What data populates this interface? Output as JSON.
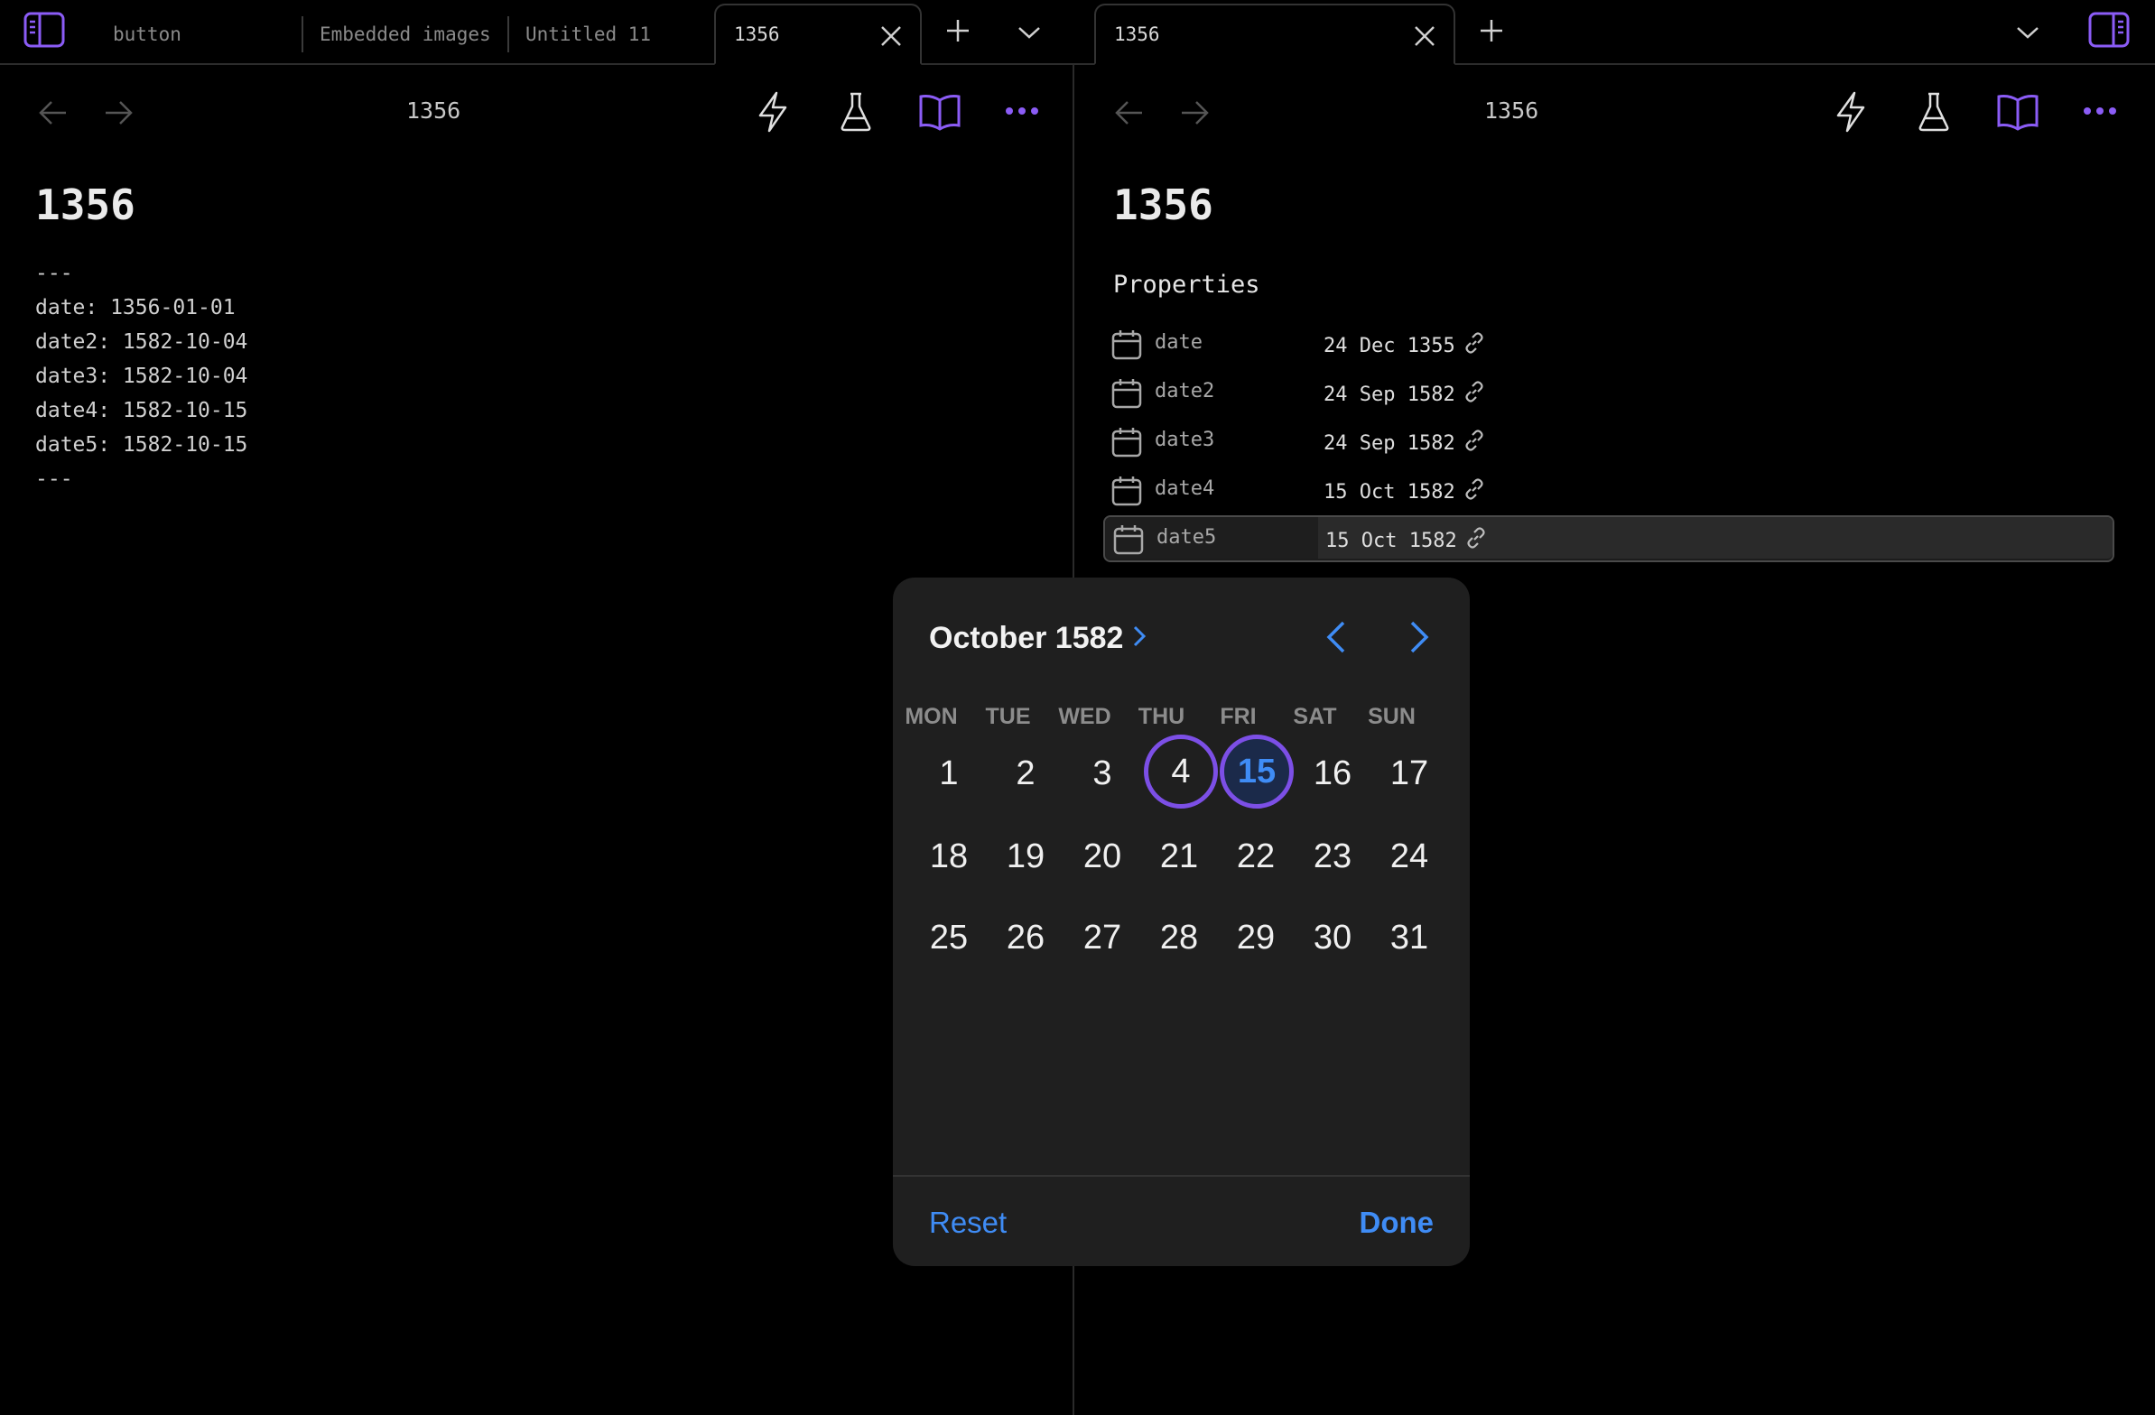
{
  "tabs": {
    "left": [
      {
        "label": "button"
      },
      {
        "label": "Embedded images"
      },
      {
        "label": "Untitled 11"
      },
      {
        "label": "1356"
      }
    ],
    "right": [
      {
        "label": "1356"
      }
    ]
  },
  "left_pane": {
    "nav_title": "1356",
    "heading": "1356",
    "source_lines": [
      "---",
      "date: 1356-01-01",
      "date2: 1582-10-04",
      "date3: 1582-10-04",
      "date4: 1582-10-15",
      "date5: 1582-10-15",
      "---"
    ]
  },
  "right_pane": {
    "nav_title": "1356",
    "heading": "1356",
    "properties_heading": "Properties",
    "properties": [
      {
        "key": "date",
        "value": "24 Dec 1355"
      },
      {
        "key": "date2",
        "value": "24 Sep 1582"
      },
      {
        "key": "date3",
        "value": "24 Sep 1582"
      },
      {
        "key": "date4",
        "value": "15 Oct 1582"
      },
      {
        "key": "date5",
        "value": "15 Oct 1582",
        "focused": true
      }
    ]
  },
  "date_picker": {
    "month_label": "October 1582",
    "weekdays": [
      "MON",
      "TUE",
      "WED",
      "THU",
      "FRI",
      "SAT",
      "SUN"
    ],
    "days": [
      "1",
      "2",
      "3",
      "4",
      "15",
      "16",
      "17",
      "18",
      "19",
      "20",
      "21",
      "22",
      "23",
      "24",
      "25",
      "26",
      "27",
      "28",
      "29",
      "30",
      "31"
    ],
    "marked_day": "4",
    "selected_day": "15",
    "reset_label": "Reset",
    "done_label": "Done",
    "accent_color": "#3f8cf5",
    "ring_color": "#7c4fe6"
  },
  "icons": {
    "accent": "#8b5cf6"
  }
}
